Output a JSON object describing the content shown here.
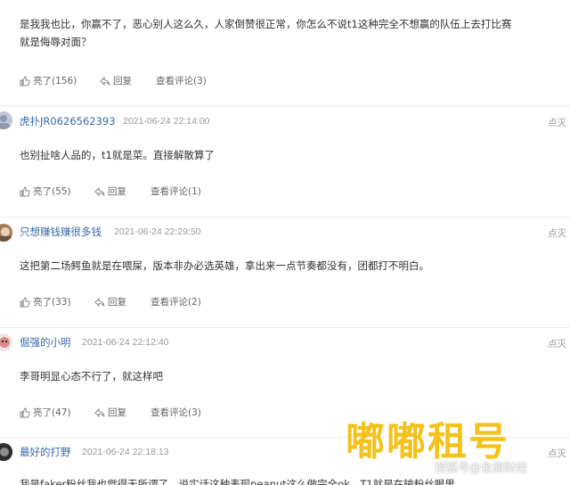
{
  "comments": [
    {
      "text_lines": [
        "是我我也比，你赢不了，恶心别人这么久，人家倒赞很正常，你怎么不说t1这种完全不想赢的队伍上去打比赛",
        "就是侮辱对面？"
      ],
      "likes": "亮了(156)",
      "reply": "回复",
      "view": "查看评论(3)"
    },
    {
      "user": "虎扑JR0626562393",
      "time": "2021-06-24 22:14:00",
      "report": "点灭",
      "text_lines": [
        "也别扯啥人品的，t1就是菜。直接解散算了"
      ],
      "likes": "亮了(55)",
      "reply": "回复",
      "view": "查看评论(1)"
    },
    {
      "user": "只想赚钱赚很多钱",
      "time": "2021-06-24 22:29:50",
      "report": "点灭",
      "text_lines": [
        "这把第二场鳄鱼就是在喂屎，版本非办必选英雄，拿出来一点节奏都没有，团都打不明白。"
      ],
      "likes": "亮了(33)",
      "reply": "回复",
      "view": "查看评论(2)"
    },
    {
      "user": "倔强的小明",
      "time": "2021-06-24 22:12:40",
      "report": "点灭",
      "text_lines": [
        "李哥明显心态不行了，就这样吧"
      ],
      "likes": "亮了(47)",
      "reply": "回复",
      "view": "查看评论(3)"
    },
    {
      "user": "最好的打野",
      "time": "2021-06-24 22:18:13",
      "report": "点灭",
      "text_lines": [
        "我是faker粉丝我也觉得无所谓了，说实话这种表现peanut这么做完全ok，T1就是在输粉丝眼里"
      ]
    }
  ],
  "watermark": {
    "text": "嘟嘟租号",
    "sub": "搜狐号@金旗财经"
  },
  "colors": {
    "username": "#3a6aa8",
    "watermark": "#f3c21b"
  }
}
